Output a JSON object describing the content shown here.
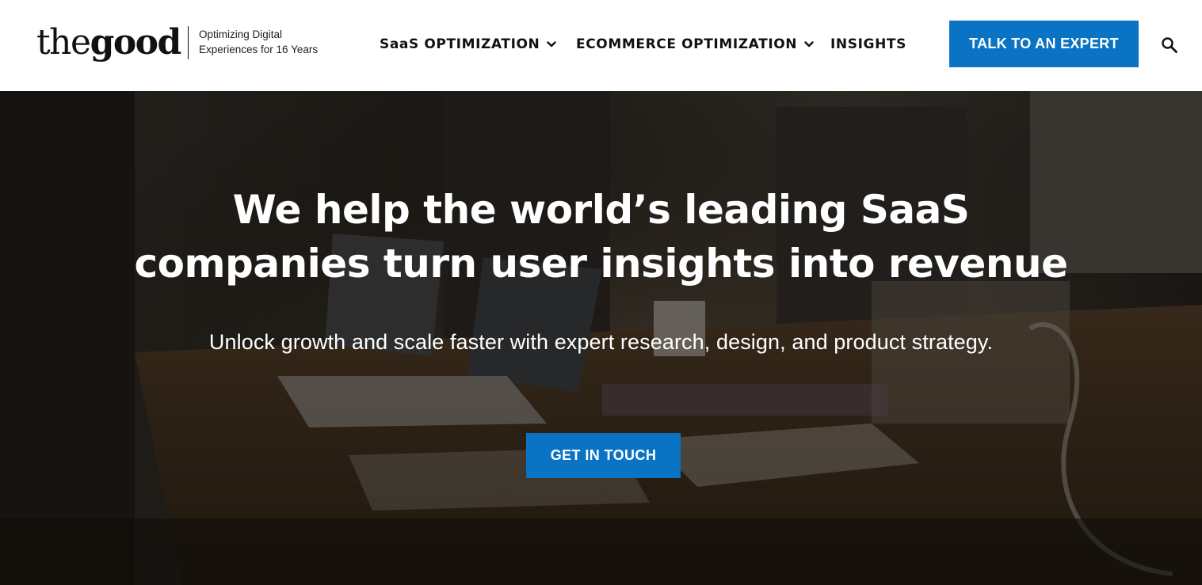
{
  "header": {
    "logo": {
      "light": "the",
      "bold": "good"
    },
    "tagline": [
      "Optimizing Digital",
      "Experiences for 16 Years"
    ],
    "nav": [
      {
        "label": "SaaS OPTIMIZATION",
        "has_dropdown": true
      },
      {
        "label": "ECOMMERCE OPTIMIZATION",
        "has_dropdown": true
      },
      {
        "label": "INSIGHTS",
        "has_dropdown": false
      }
    ],
    "cta_label": "TALK TO AN EXPERT",
    "search_icon": "search-icon"
  },
  "hero": {
    "title_lines": [
      "We help the world’s leading SaaS",
      "companies turn user insights into revenue"
    ],
    "subtitle": "Unlock growth and scale faster with expert research, design, and product strategy.",
    "cta_label": "GET IN TOUCH",
    "background": "dimmed photo of people working at a table with laptops"
  },
  "colors": {
    "accent": "#0b73c4",
    "header_bg": "#ffffff",
    "text_dark": "#111111",
    "text_light": "#ffffff"
  }
}
